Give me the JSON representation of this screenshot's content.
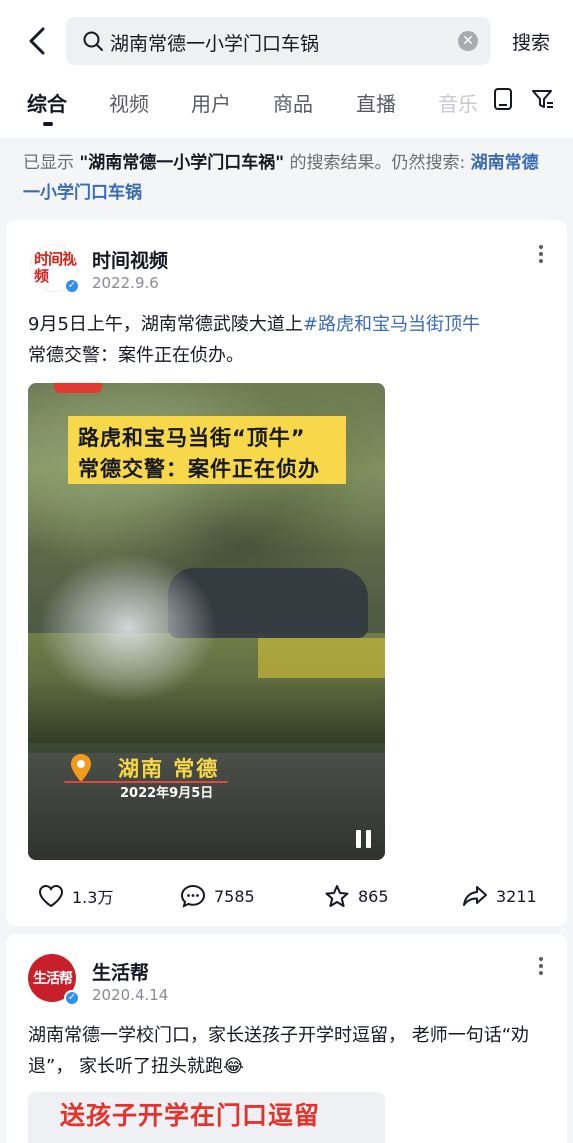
{
  "search": {
    "query": "湖南常德一小学门口车锅",
    "button_label": "搜索"
  },
  "tabs": [
    {
      "label": "综合",
      "active": true
    },
    {
      "label": "视频",
      "active": false
    },
    {
      "label": "用户",
      "active": false
    },
    {
      "label": "商品",
      "active": false
    },
    {
      "label": "直播",
      "active": false
    },
    {
      "label": "音乐",
      "active": false
    }
  ],
  "notice": {
    "prefix": "已显示 ",
    "corrected": "\"湖南常德一小学门口车祸\"",
    "middle": " 的搜索结果。仍然搜索: ",
    "original": "湖南常德一小学门口车锅"
  },
  "posts": [
    {
      "author": "时间视频",
      "avatar_text": "时间视频",
      "date": "2022.9.6",
      "text_before": "9月5日上午，湖南常德武陵大道上",
      "hashtag": "#路虎和宝马当街顶牛",
      "text_after": "常德交警：案件正在侦办。",
      "video": {
        "caption_line1": "路虎和宝马当街“顶牛”",
        "caption_line2": "常德交警：案件正在侦办",
        "location": "湖南 常德",
        "date": "2022年9月5日"
      },
      "likes": "1.3万",
      "comments": "7585",
      "favorites": "865",
      "shares": "3211"
    },
    {
      "author": "生活帮",
      "avatar_text": "生活帮",
      "date": "2020.4.14",
      "text": "湖南常德一学校门口，家长送孩子开学时逗留， 老师一句话“劝退”， 家长听了扭头就跑😂",
      "thumb_title": "送孩子开学在门口逗留"
    }
  ],
  "colors": {
    "accent_link": "#3a6bb5",
    "caption_yellow": "#f6d84a",
    "verified_blue": "#2f8ef5"
  },
  "icons": [
    "back-arrow-icon",
    "search-icon",
    "clear-icon",
    "tablet-icon",
    "filter-icon",
    "more-dots-icon",
    "heart-icon",
    "comment-icon",
    "star-icon",
    "share-icon",
    "location-pin-icon",
    "pause-icon"
  ]
}
